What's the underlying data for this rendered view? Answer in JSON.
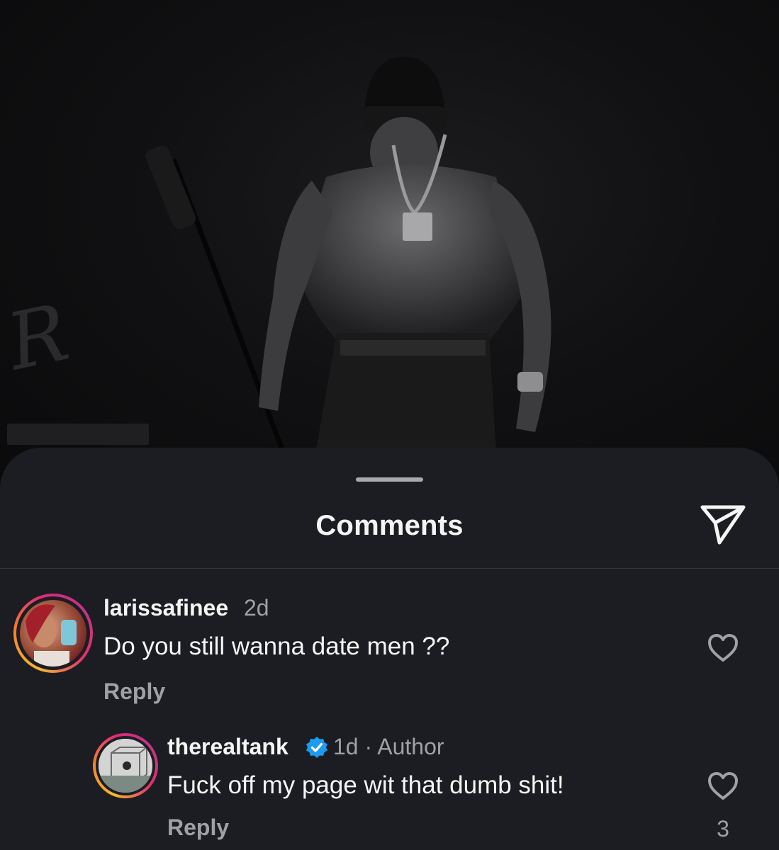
{
  "sheet": {
    "title": "Comments"
  },
  "icons": {
    "share": "paper-plane-icon",
    "like": "heart-outline-icon",
    "verified": "verified-badge-icon"
  },
  "colors": {
    "sheet_bg": "#1c1d22",
    "text_primary": "#f5f5f5",
    "text_secondary": "#a0a0a6",
    "verified_blue": "#1d9bf0"
  },
  "comments": [
    {
      "username": "larissafinee",
      "time": "2d",
      "text": "Do you still wanna date men ??",
      "reply_label": "Reply"
    }
  ],
  "replies": [
    {
      "username": "therealtank",
      "verified": true,
      "meta": "1d · Author",
      "text": "Fuck off my page wit that dumb shit!",
      "reply_label": "Reply",
      "like_count": "3"
    }
  ]
}
